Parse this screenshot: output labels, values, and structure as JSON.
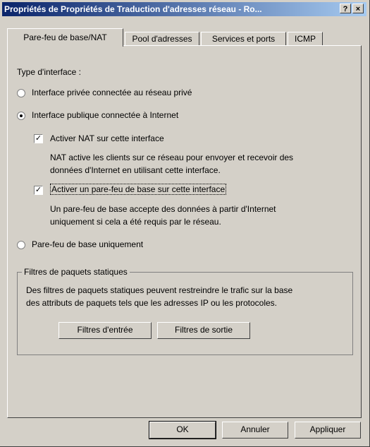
{
  "window": {
    "title": "Propriétés de Propriétés de Traduction d'adresses réseau - Ro...",
    "help_button": "?",
    "close_button": "×"
  },
  "tabs": [
    {
      "label": "Pare-feu de base/NAT"
    },
    {
      "label": "Pool d'adresses"
    },
    {
      "label": "Services et ports"
    },
    {
      "label": "ICMP"
    }
  ],
  "panel": {
    "interface_type_label": "Type d'interface :",
    "radio_private": {
      "label": "Interface privée connectée au réseau privé",
      "checked": false
    },
    "radio_public": {
      "label": "Interface publique connectée à Internet",
      "checked": true
    },
    "check_nat": {
      "label": "Activer NAT sur cette interface",
      "checked": true
    },
    "nat_desc_line1": "NAT active les clients sur ce réseau pour envoyer et recevoir des",
    "nat_desc_line2": "données d'Internet en utilisant cette interface.",
    "check_firewall": {
      "label": "Activer un pare-feu de base sur cette interface",
      "checked": true
    },
    "fw_desc_line1": "Un pare-feu de base accepte des données à partir d'Internet",
    "fw_desc_line2": "uniquement si cela a été requis par le réseau.",
    "radio_basic_fw": {
      "label": "Pare-feu de base uniquement",
      "checked": false
    },
    "filters_group": {
      "legend": "Filtres de paquets statiques",
      "desc_line1": "Des filtres de paquets statiques peuvent restreindre le trafic sur la base",
      "desc_line2": "des attributs de paquets tels que les adresses IP ou les protocoles.",
      "input_filters_button": "Filtres d'entrée",
      "output_filters_button": "Filtres de sortie"
    }
  },
  "footer": {
    "ok": "OK",
    "cancel": "Annuler",
    "apply": "Appliquer"
  },
  "check_glyph": "✓"
}
